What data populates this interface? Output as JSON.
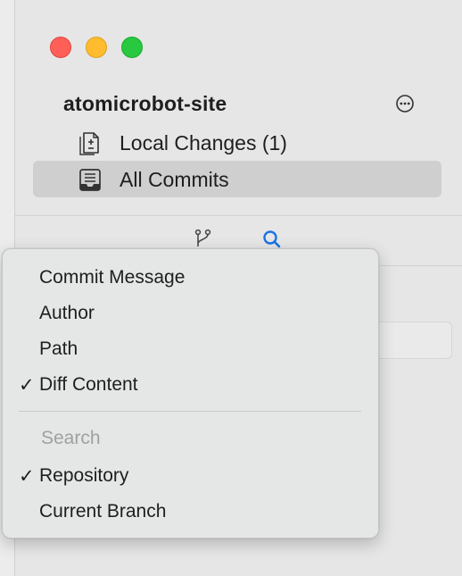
{
  "window": {
    "traffic_lights": [
      "close",
      "minimize",
      "zoom"
    ]
  },
  "sidebar": {
    "repo_name": "atomicrobot-site",
    "items": [
      {
        "label": "Local Changes (1)",
        "icon": "diff-document-icon",
        "selected": false
      },
      {
        "label": "All Commits",
        "icon": "inbox-tray-icon",
        "selected": true
      }
    ]
  },
  "toolbar": {
    "icons": [
      "branch-icon",
      "search-icon"
    ],
    "active": "search-icon"
  },
  "menu": {
    "fields": [
      {
        "label": "Commit Message",
        "checked": false
      },
      {
        "label": "Author",
        "checked": false
      },
      {
        "label": "Path",
        "checked": false
      },
      {
        "label": "Diff Content",
        "checked": true
      }
    ],
    "scope_header": "Search",
    "scopes": [
      {
        "label": "Repository",
        "checked": true
      },
      {
        "label": "Current Branch",
        "checked": false
      }
    ],
    "check_glyph": "✓"
  },
  "colors": {
    "accent": "#1a73e8",
    "selection": "#cfcfcf",
    "close": "#fe5f57",
    "minimize": "#febc2e",
    "zoom": "#28c840"
  }
}
